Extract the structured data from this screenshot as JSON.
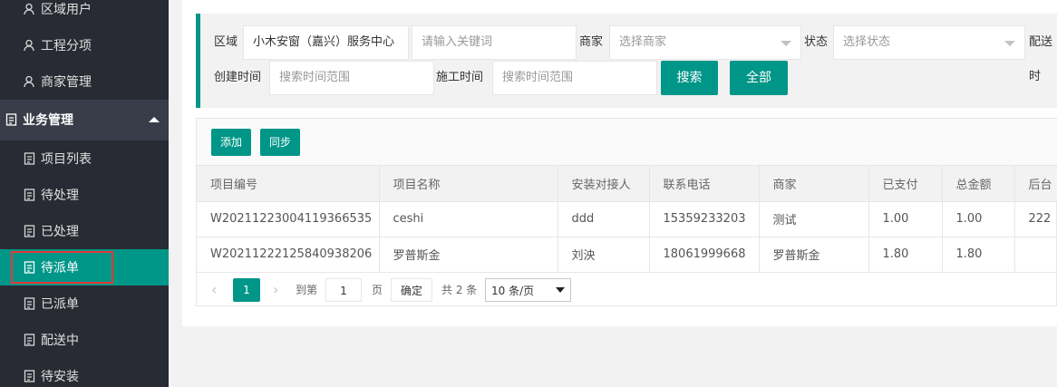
{
  "sidebar": {
    "items": [
      {
        "label": "区域用户",
        "icon": "user-icon"
      },
      {
        "label": "工程分项",
        "icon": "user-icon"
      },
      {
        "label": "商家管理",
        "icon": "user-icon"
      },
      {
        "label": "业务管理",
        "icon": "document-icon"
      },
      {
        "label": "项目列表",
        "icon": "document-icon"
      },
      {
        "label": "待处理",
        "icon": "document-icon"
      },
      {
        "label": "已处理",
        "icon": "document-icon"
      },
      {
        "label": "待派单",
        "icon": "document-icon"
      },
      {
        "label": "已派单",
        "icon": "document-icon"
      },
      {
        "label": "配送中",
        "icon": "document-icon"
      },
      {
        "label": "待安装",
        "icon": "document-icon"
      }
    ],
    "active_label": "待派单"
  },
  "filter": {
    "region_label": "区域",
    "region_value": "小木安窗（嘉兴）服务中心",
    "keyword_placeholder": "请输入关键词",
    "merchant_label": "商家",
    "merchant_placeholder": "选择商家",
    "status_label": "状态",
    "status_placeholder": "选择状态",
    "delivery_label": "配送时",
    "created_label": "创建时间",
    "created_placeholder": "搜索时间范围",
    "construction_label": "施工时间",
    "construction_placeholder": "搜索时间范围",
    "search_button": "搜索",
    "all_button": "全部"
  },
  "toolbar": {
    "add_button": "添加",
    "sync_button": "同步"
  },
  "table": {
    "columns": [
      "项目编号",
      "项目名称",
      "安装对接人",
      "联系电话",
      "商家",
      "已支付",
      "总金额",
      "后台"
    ],
    "rows": [
      [
        "W20211223004119366535",
        "ceshi",
        "ddd",
        "15359233203",
        "测试",
        "1.00",
        "1.00",
        "222"
      ],
      [
        "W20211222125840938206",
        "罗普斯金",
        "刘泱",
        "18061999668",
        "罗普斯金",
        "1.80",
        "1.80",
        ""
      ]
    ]
  },
  "pager": {
    "prev": "‹",
    "current": "1",
    "next": "›",
    "goto_label": "到第",
    "page_value": "1",
    "page_unit": "页",
    "confirm": "确定",
    "total": "共 2 条",
    "page_size": "10 条/页"
  },
  "colors": {
    "accent": "#009688",
    "sidebar_bg": "#393d49",
    "sidebar_sub_bg": "#282b33",
    "highlight": "#e53935"
  }
}
